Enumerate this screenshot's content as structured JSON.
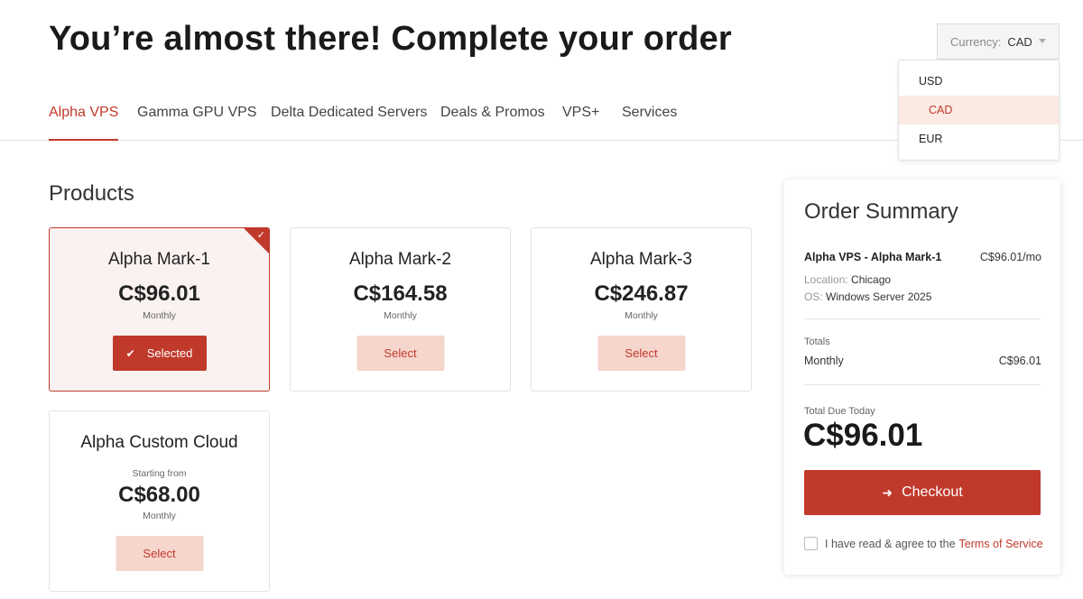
{
  "header": {
    "title": "You’re almost there! Complete your order"
  },
  "currency": {
    "label": "Currency:",
    "selected": "CAD",
    "options": [
      "USD",
      "CAD",
      "EUR"
    ]
  },
  "tabs": [
    {
      "label": "Alpha VPS",
      "active": true
    },
    {
      "label": "Gamma GPU VPS",
      "active": false
    },
    {
      "label": "Delta Dedicated Servers",
      "active": false
    },
    {
      "label": "Deals & Promos",
      "active": false
    },
    {
      "label": "VPS+",
      "active": false
    },
    {
      "label": "Services",
      "active": false
    }
  ],
  "products": {
    "title": "Products",
    "items": [
      {
        "name": "Alpha Mark-1",
        "price": "C$96.01",
        "period": "Monthly",
        "button": "Selected",
        "selected": true
      },
      {
        "name": "Alpha Mark-2",
        "price": "C$164.58",
        "period": "Monthly",
        "button": "Select",
        "selected": false
      },
      {
        "name": "Alpha Mark-3",
        "price": "C$246.87",
        "period": "Monthly",
        "button": "Select",
        "selected": false
      },
      {
        "name": "Alpha Custom Cloud",
        "starting": "Starting from",
        "price": "C$68.00",
        "period": "Monthly",
        "button": "Select",
        "selected": false
      }
    ]
  },
  "summary": {
    "title": "Order Summary",
    "item_name": "Alpha VPS - Alpha Mark-1",
    "item_price": "C$96.01/mo",
    "location_label": "Location:",
    "location": "Chicago",
    "os_label": "OS:",
    "os": "Windows Server 2025",
    "totals_label": "Totals",
    "monthly_label": "Monthly",
    "monthly_value": "C$96.01",
    "due_label": "Total Due Today",
    "due_value": "C$96.01",
    "checkout_label": "Checkout",
    "tos_text": "I have read & agree to the",
    "tos_link": "Terms of Service"
  },
  "colors": {
    "accent": "#c0392b",
    "accent_light": "#f6d5cd",
    "selected_bg": "#faf2f0"
  },
  "icons": {
    "check": "check-icon",
    "arrow": "arrow-right-icon",
    "caret": "caret-down-icon"
  }
}
